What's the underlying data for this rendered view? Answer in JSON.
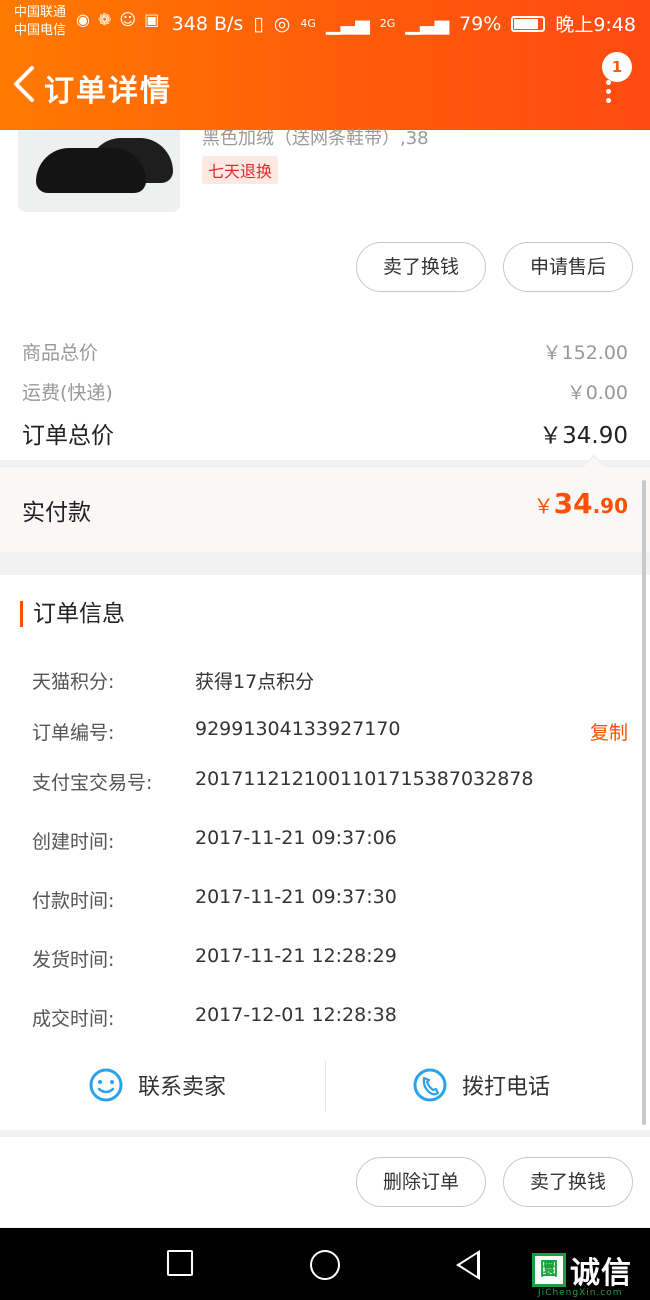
{
  "status_bar": {
    "carrier_1": "中国联通",
    "carrier_2": "中国电信",
    "net_speed": "348 B/s",
    "signal_1": "4G",
    "signal_2": "2G",
    "battery": "79%",
    "time": "晚上9:48"
  },
  "header": {
    "title": "订单详情",
    "badge_count": "1"
  },
  "product": {
    "subtitle": "黑色加绒（送网条鞋带）,38",
    "tag": "七天退换",
    "buttons": {
      "sell": "卖了换钱",
      "after_sale": "申请售后"
    }
  },
  "pricing": {
    "goods_total_label": "商品总价",
    "goods_total": "￥152.00",
    "shipping_label": "运费(快递)",
    "shipping": "￥0.00",
    "order_total_label": "订单总价",
    "order_total": "￥34.90",
    "paid_label": "实付款",
    "paid_currency": "￥",
    "paid_int": "34",
    "paid_dec": ".90"
  },
  "order_info": {
    "heading": "订单信息",
    "copy_label": "复制",
    "rows": [
      {
        "k": "天猫积分:",
        "v": "获得17点积分"
      },
      {
        "k": "订单编号:",
        "v": "92991304133927170"
      },
      {
        "k": "支付宝交易号:",
        "v": "2017112121001101715387032878"
      },
      {
        "k": "创建时间:",
        "v": "2017-11-21 09:37:06"
      },
      {
        "k": "付款时间:",
        "v": "2017-11-21 09:37:30"
      },
      {
        "k": "发货时间:",
        "v": "2017-11-21 12:28:29"
      },
      {
        "k": "成交时间:",
        "v": "2017-12-01 12:28:38"
      }
    ],
    "contact_seller": "联系卖家",
    "call_phone": "拨打电话"
  },
  "bottom_actions": {
    "delete": "删除订单",
    "sell": "卖了换钱"
  },
  "watermark": {
    "logo": "圜",
    "text": "诚信",
    "sub": "JiChengXin.com"
  },
  "colors": {
    "accent": "#ff5000",
    "header_start": "#ff7a00",
    "icon_blue": "#2aa3e8"
  }
}
